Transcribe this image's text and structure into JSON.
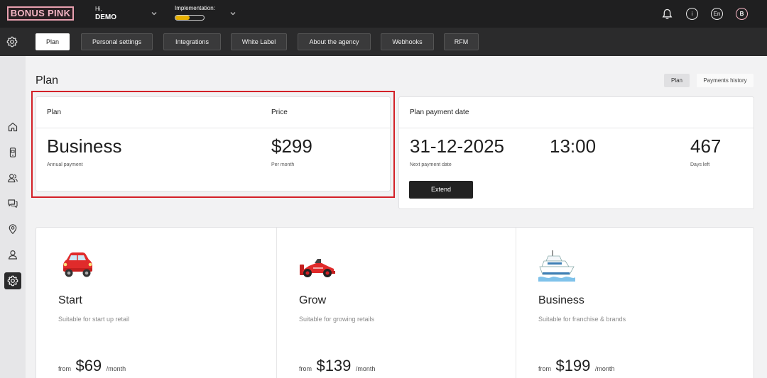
{
  "topbar": {
    "logo": "BONUS PINK",
    "greeting": "Hi,",
    "user_name": "DEMO",
    "implementation_label": "Implementation:",
    "implementation_progress": 0.5,
    "language": "En",
    "avatar_letter": "B",
    "info_glyph": "i",
    "icons": [
      "bell-icon",
      "info-icon",
      "language-icon",
      "avatar"
    ]
  },
  "tabs": [
    {
      "label": "Plan",
      "active": true
    },
    {
      "label": "Personal settings"
    },
    {
      "label": "Integrations"
    },
    {
      "label": "White Label"
    },
    {
      "label": "About the agency"
    },
    {
      "label": "Webhooks"
    },
    {
      "label": "RFM"
    }
  ],
  "sidebar": {
    "items": [
      "home-icon",
      "mobile-card-icon",
      "users-icon",
      "chat-icon",
      "location-icon",
      "profile-icon",
      "settings-icon"
    ],
    "active": "settings-icon"
  },
  "page": {
    "title": "Plan",
    "segments": {
      "plan": "Plan",
      "history": "Payments history"
    }
  },
  "current_plan": {
    "plan_header": "Plan",
    "price_header": "Price",
    "plan_name": "Business",
    "plan_sub": "Annual payment",
    "price": "$299",
    "price_sub": "Per month"
  },
  "payment": {
    "header": "Plan payment date",
    "date": "31-12-2025",
    "date_sub": "Next payment date",
    "time": "13:00",
    "days": "467",
    "days_sub": "Days left",
    "extend_label": "Extend"
  },
  "plans": [
    {
      "name": "Start",
      "desc": "Suitable for start up retail",
      "from": "from",
      "price": "$69",
      "per": "/month",
      "icon": "car-icon"
    },
    {
      "name": "Grow",
      "desc": "Suitable for growing retails",
      "from": "from",
      "price": "$139",
      "per": "/month",
      "icon": "race-car-icon"
    },
    {
      "name": "Business",
      "desc": "Suitable for franchise & brands",
      "from": "from",
      "price": "$199",
      "per": "/month",
      "icon": "yacht-icon"
    }
  ],
  "colors": {
    "accent_pink": "#f7b7c6",
    "highlight_red": "#d32027",
    "progress_yellow": "#e8b100",
    "dark": "#1f1f20"
  }
}
